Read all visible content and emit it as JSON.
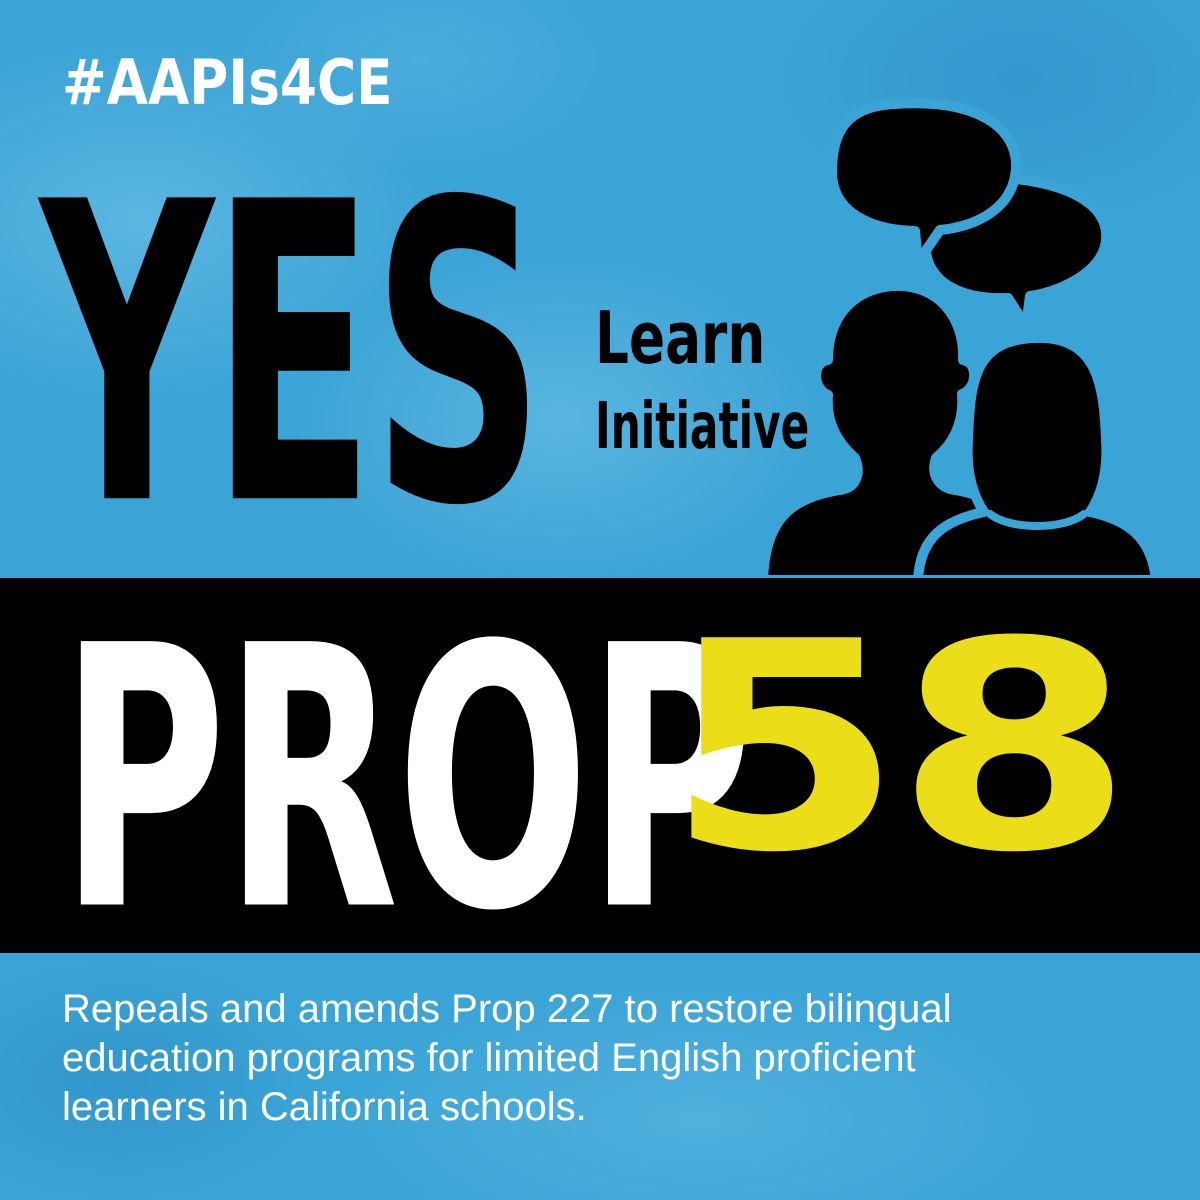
{
  "hashtag": "#AAPIs4CE",
  "headline": {
    "yes": "YES",
    "learn": "Learn",
    "initiative": "Initiative",
    "prop": "PROP",
    "number": "58"
  },
  "description": {
    "lines": [
      "Repeals and amends Prop 227 to restore bilingual",
      "education programs for limited English proficient",
      "learners in California schools."
    ]
  },
  "icons": {
    "graphic": "two-people-conversation-icon",
    "bubbles": "speech-bubbles-icon"
  },
  "colors": {
    "background": "#3ba4d6",
    "band": "#000000",
    "number": "#ebdd17",
    "text_light": "#ffffff",
    "text_dark": "#000000"
  }
}
